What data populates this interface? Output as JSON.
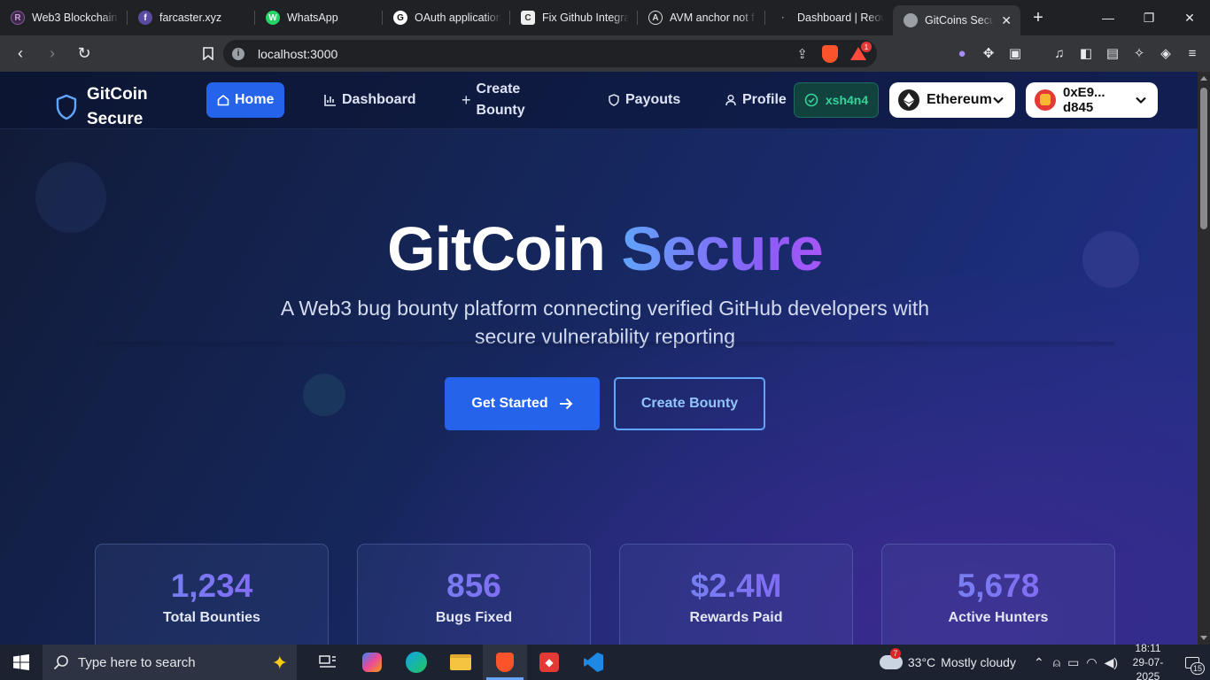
{
  "browser": {
    "tabs": [
      {
        "title": "Web3 Blockchain I",
        "icon": "R",
        "icon_color": "#5b2c6f"
      },
      {
        "title": "farcaster.xyz",
        "icon": "f",
        "icon_color": "#7c65c1"
      },
      {
        "title": "WhatsApp",
        "icon": "W",
        "icon_color": "#25d366"
      },
      {
        "title": "OAuth application",
        "icon": "G",
        "icon_color": "#ffffff"
      },
      {
        "title": "Fix Github Integra",
        "icon": "C",
        "icon_color": "#ffffff"
      },
      {
        "title": "AVM anchor not f",
        "icon": "A",
        "icon_color": "#ffffff"
      },
      {
        "title": "Dashboard | Reow",
        "icon": "·",
        "icon_color": "#ffffff"
      },
      {
        "title": "GitCoins Secu",
        "icon": "●",
        "icon_color": "#9aa0a6"
      }
    ],
    "url": "localhost:3000",
    "notification_count": "1"
  },
  "app": {
    "brand_line1": "GitCoin",
    "brand_line2": "Secure",
    "nav": {
      "home": "Home",
      "dashboard": "Dashboard",
      "create_bounty_line1": "Create",
      "create_bounty_line2": "Bounty",
      "payouts": "Payouts",
      "profile": "Profile"
    },
    "github_user": "xsh4n4",
    "network": "Ethereum",
    "wallet_line1": "0xE9...",
    "wallet_line2": "d845"
  },
  "hero": {
    "title_plain": "GitCoin",
    "title_accent": "Secure",
    "subtitle": "A Web3 bug bounty platform connecting verified GitHub developers with secure vulnerability reporting",
    "cta_primary": "Get Started",
    "cta_secondary": "Create Bounty"
  },
  "stats": [
    {
      "value": "1,234",
      "label": "Total Bounties"
    },
    {
      "value": "856",
      "label": "Bugs Fixed"
    },
    {
      "value": "$2.4M",
      "label": "Rewards Paid"
    },
    {
      "value": "5,678",
      "label": "Active Hunters"
    }
  ],
  "taskbar": {
    "search_placeholder": "Type here to search",
    "weather_badge": "7",
    "temperature": "33°C",
    "weather": "Mostly cloudy",
    "time": "18:11",
    "date": "29-07-2025",
    "notifications": "15"
  },
  "colors": {
    "accent": "#2563eb",
    "accent_light": "#60a5fa",
    "purple": "#8b5cf6",
    "github_badge": "#34d399"
  }
}
